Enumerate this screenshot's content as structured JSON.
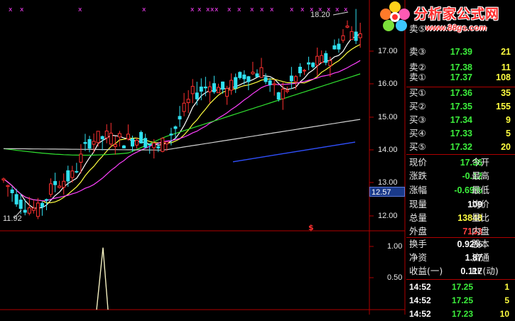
{
  "chart": {
    "price_ticks": [
      "17.00",
      "16.00",
      "15.00",
      "14.00",
      "13.00",
      "12.00"
    ],
    "current_price_label": "12.57",
    "high_label": "18.20",
    "low_label": "11.92",
    "signal_marker": "$",
    "indicator_ticks": [
      "1.00",
      "0.50"
    ],
    "colors": {
      "up": "#ff3030",
      "down": "#30e0f0",
      "ma5": "#ffffff",
      "ma10": "#ffff40",
      "ma20": "#ff40ff",
      "ma60": "#30e030",
      "ma120": "#d0d0d0",
      "ma250": "#3050ff",
      "grid": "#b00000"
    }
  },
  "chart_data": {
    "type": "candlestick",
    "price_range": [
      11.6,
      18.3
    ],
    "indicator_range": [
      0,
      1.1
    ],
    "signal_spike": {
      "bar_index": 39,
      "value": 1.0
    }
  },
  "watermark": {
    "title": "分析家公式网",
    "url": "www.88gs.com"
  },
  "quote": {
    "top_partial": "卖⑤",
    "asks": [
      {
        "label": "卖③",
        "price": "17.39",
        "vol": "21"
      },
      {
        "label": "卖②",
        "price": "17.38",
        "vol": "11"
      },
      {
        "label": "卖①",
        "price": "17.37",
        "vol": "108"
      }
    ],
    "bids": [
      {
        "label": "买①",
        "price": "17.36",
        "vol": "35"
      },
      {
        "label": "买②",
        "price": "17.35",
        "vol": "155"
      },
      {
        "label": "买③",
        "price": "17.34",
        "vol": "9"
      },
      {
        "label": "买④",
        "price": "17.33",
        "vol": "5"
      },
      {
        "label": "买⑤",
        "price": "17.32",
        "vol": "20"
      }
    ],
    "stats": [
      {
        "k": "现价",
        "v": "17.36",
        "c": "green",
        "k2": "今开"
      },
      {
        "k": "涨跌",
        "v": "-0.12",
        "c": "green",
        "k2": "最高"
      },
      {
        "k": "涨幅",
        "v": "-0.69%",
        "c": "green",
        "k2": "最低"
      },
      {
        "k": "现量",
        "v": "109",
        "c": "white",
        "k2": "均价"
      },
      {
        "k": "总量",
        "v": "13848",
        "c": "yellow",
        "k2": "量比"
      },
      {
        "k": "外盘",
        "v": "7133",
        "c": "red",
        "k2": "内盘"
      }
    ],
    "stats2": [
      {
        "k": "换手",
        "v": "0.92%",
        "c": "white",
        "k2": "股本"
      },
      {
        "k": "净资",
        "v": "1.87",
        "c": "white",
        "k2": "流通"
      },
      {
        "k": "收益(一)",
        "v": "0.117",
        "c": "white",
        "k2": "PE(动)"
      }
    ],
    "trades": [
      {
        "t": "14:52",
        "p": "17.25",
        "v": "1"
      },
      {
        "t": "14:52",
        "p": "17.25",
        "v": "5"
      },
      {
        "t": "14:52",
        "p": "17.23",
        "v": "10"
      }
    ]
  }
}
